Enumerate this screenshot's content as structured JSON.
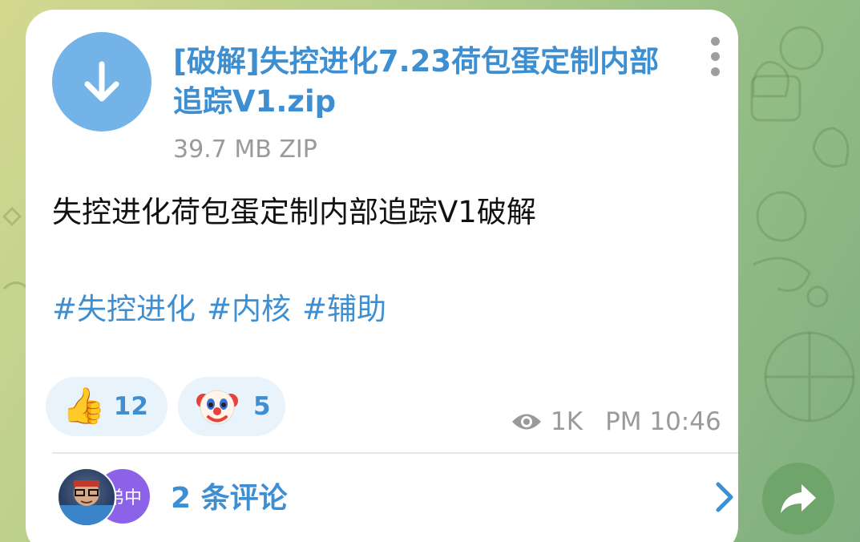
{
  "file": {
    "name": "[破解]失控进化7.23荷包蛋定制内部追踪V1.zip",
    "meta": "39.7 MB ZIP",
    "download_icon": "arrow-down-icon"
  },
  "message": {
    "text": "失控进化荷包蛋定制内部追踪V1破解",
    "hashtags": [
      "#失控进化",
      "#内核",
      "#辅助"
    ]
  },
  "reactions": [
    {
      "emoji": "👍",
      "icon": "thumbs-up-icon",
      "count": "12"
    },
    {
      "emoji": "🤡",
      "icon": "clown-face-icon",
      "count": "5"
    }
  ],
  "meta": {
    "views": "1K",
    "time": "PM 10:46",
    "views_icon": "eye-icon"
  },
  "comments": {
    "label": "2 条评论",
    "avatar2_text": "弟中"
  },
  "colors": {
    "accent": "#3d8fd1",
    "download": "#74b3e8",
    "share": "#6fa56a",
    "avatar_purple": "#8c63e8"
  }
}
